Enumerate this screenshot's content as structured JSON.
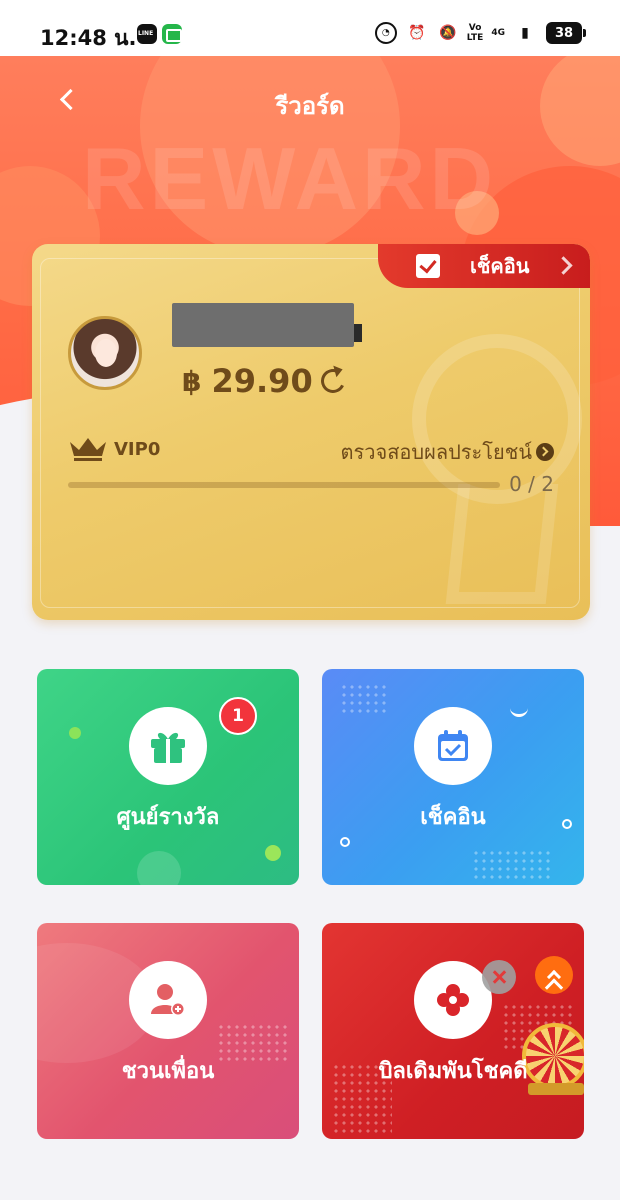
{
  "status_bar": {
    "time": "12:48 น.",
    "apps": [
      "line-icon",
      "message-icon"
    ],
    "indicators": [
      "speed-icon",
      "alarm-icon",
      "mute-icon",
      "volte-icon",
      "4g-icon",
      "signal-icon"
    ],
    "volte_label": "Vo\nLTE",
    "network_label": "4G",
    "battery": "38"
  },
  "header": {
    "title": "รีวอร์ด",
    "watermark": "REWARD"
  },
  "vip_card": {
    "checkin_label": "เช็คอิน",
    "balance_symbol": "฿",
    "balance": "29.90",
    "vip_level": "VIP0",
    "benefits_label": "ตรวจสอบผลประโยชน์",
    "progress_text": "0 / 2",
    "progress_current": 0,
    "progress_max": 2
  },
  "tiles": [
    {
      "label": "ศูนย์รางวัล",
      "icon": "gift-icon",
      "badge": "1"
    },
    {
      "label": "เช็คอิน",
      "icon": "calendar-check-icon"
    },
    {
      "label": "ชวนเพื่อน",
      "icon": "add-friend-icon"
    },
    {
      "label": "บิลเดิมพันโชคดี",
      "icon": "clover-icon"
    }
  ],
  "colors": {
    "hero_orange": "#ff6a45",
    "card_gold": "#eecb6b",
    "checkin_red": "#d22a22",
    "tile_green": "#2bc478",
    "tile_blue": "#3b9ef1",
    "tile_pink": "#e2546e",
    "tile_red": "#cf1f24"
  }
}
